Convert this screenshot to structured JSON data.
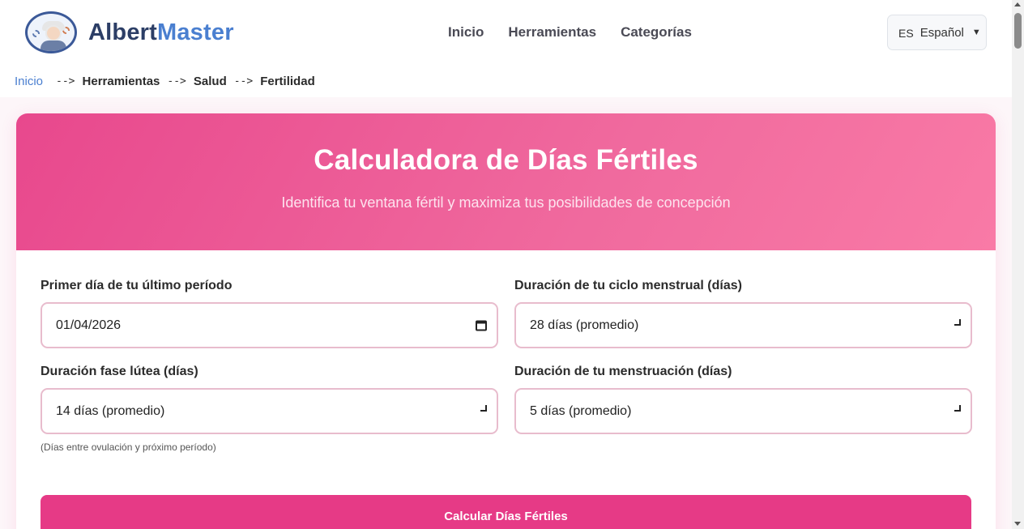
{
  "brand": {
    "name_part1": "Albert",
    "name_part2": "Master"
  },
  "nav": {
    "items": [
      "Inicio",
      "Herramientas",
      "Categorías"
    ]
  },
  "language": {
    "code": "ES",
    "label": "Español"
  },
  "breadcrumb": {
    "home": "Inicio",
    "separator": "-->",
    "items": [
      "Herramientas",
      "Salud",
      "Fertilidad"
    ]
  },
  "hero": {
    "title": "Calculadora de Días Fértiles",
    "subtitle": "Identifica tu ventana fértil y maximiza tus posibilidades de concepción"
  },
  "form": {
    "last_period": {
      "label": "Primer día de tu último período",
      "value": "01/04/2026"
    },
    "cycle_length": {
      "label": "Duración de tu ciclo menstrual (días)",
      "value": "28 días (promedio)"
    },
    "luteal_phase": {
      "label": "Duración fase lútea (días)",
      "value": "14 días (promedio)",
      "hint": "(Días entre ovulación y próximo período)"
    },
    "period_length": {
      "label": "Duración de tu menstruación (días)",
      "value": "5 días (promedio)"
    },
    "submit_label": "Calcular Días Fértiles"
  },
  "colors": {
    "accent": "#e63a86",
    "brand_dark": "#2c3e66",
    "brand_light": "#4a7fd0",
    "link": "#4a7fd0"
  }
}
